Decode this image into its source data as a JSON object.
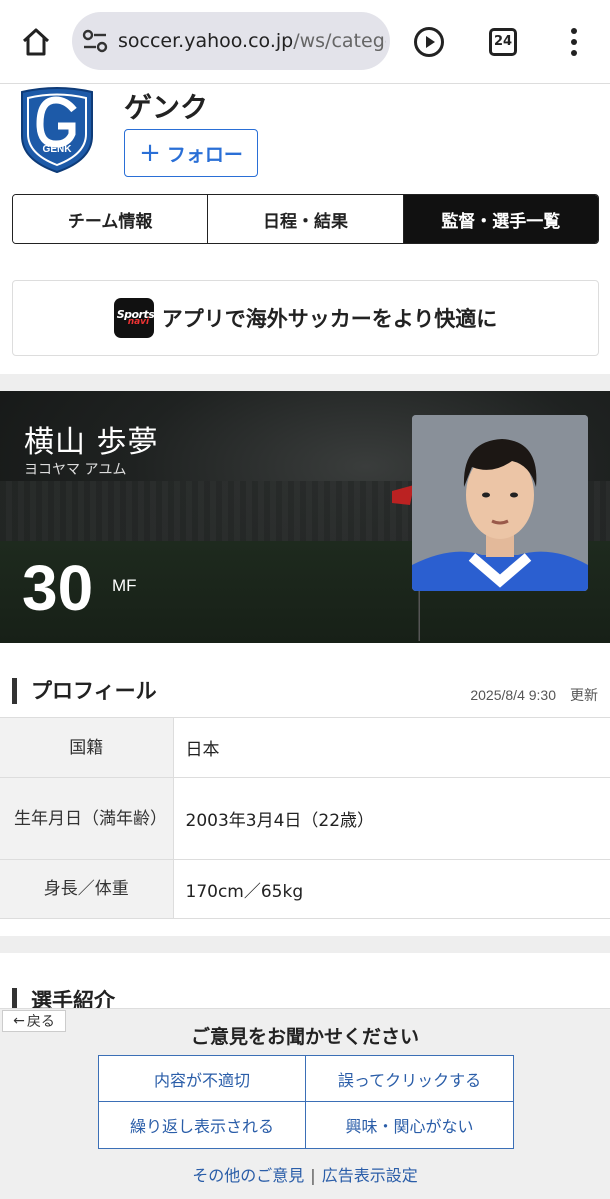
{
  "browser": {
    "url_host": "soccer.yahoo.co.jp",
    "url_path": "/ws/catego",
    "tab_count": "24"
  },
  "team": {
    "name": "ゲンク",
    "logo_text": "GENK",
    "follow_label": "フォロー"
  },
  "tabs": [
    {
      "label": "チーム情報",
      "active": false
    },
    {
      "label": "日程・結果",
      "active": false
    },
    {
      "label": "監督・選手一覧",
      "active": true
    }
  ],
  "app_banner": {
    "text": "アプリで海外サッカーをより快適に"
  },
  "player": {
    "name": "横山 歩夢",
    "kana": "ヨコヤマ アユム",
    "number": "30",
    "position": "MF"
  },
  "profile": {
    "title": "プロフィール",
    "updated": "2025/8/4 9:30　更新",
    "rows": [
      {
        "key": "国籍",
        "value": "日本"
      },
      {
        "key": "生年月日（満年齢）",
        "value": "2003年3月4日（22歳）"
      },
      {
        "key": "身長／体重",
        "value": "170cm／65kg"
      }
    ]
  },
  "intro": {
    "title": "選手紹介"
  },
  "feedback": {
    "back_label": "戻る",
    "title": "ご意見をお聞かせください",
    "options": [
      "内容が不適切",
      "誤ってクリックする",
      "繰り返し表示される",
      "興味・関心がない"
    ],
    "other_link": "その他のご意見",
    "ad_settings_link": "広告表示設定"
  },
  "colors": {
    "accent_blue": "#2a6fd6",
    "active_tab": "#111111",
    "genk_blue": "#1d5aa8"
  }
}
